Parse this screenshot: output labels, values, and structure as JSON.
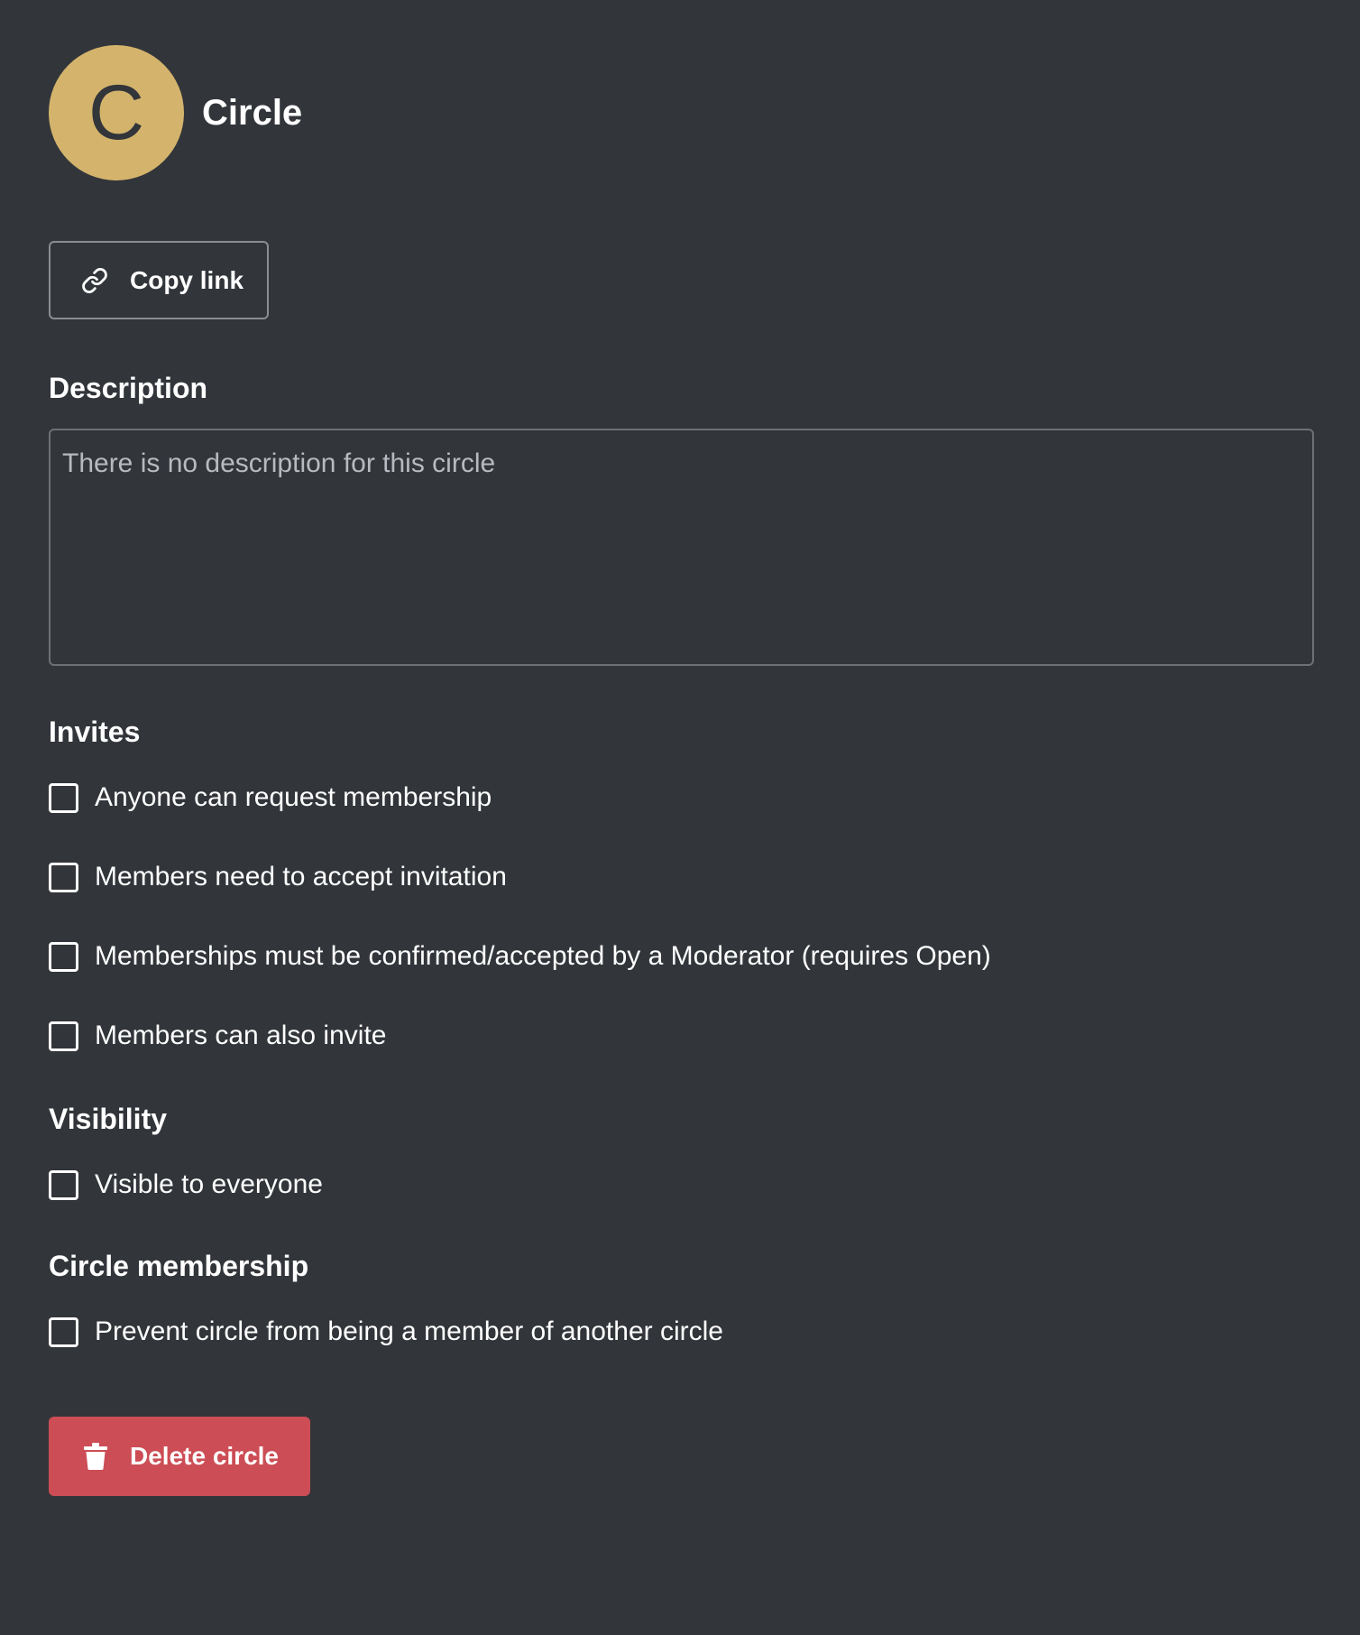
{
  "colors": {
    "background": "#32353a",
    "avatar": "#d4b46c",
    "danger": "#cc4d55"
  },
  "circle": {
    "avatar_letter": "C",
    "name": "Circle"
  },
  "copy_link": {
    "label": "Copy link",
    "icon": "link-icon"
  },
  "description": {
    "title": "Description",
    "placeholder": "There is no description for this circle",
    "value": ""
  },
  "invites": {
    "title": "Invites",
    "options": [
      {
        "label": "Anyone can request membership",
        "checked": false
      },
      {
        "label": "Members need to accept invitation",
        "checked": false
      },
      {
        "label": "Memberships must be confirmed/accepted by a Moderator (requires Open)",
        "checked": false
      },
      {
        "label": "Members can also invite",
        "checked": false
      }
    ]
  },
  "visibility": {
    "title": "Visibility",
    "options": [
      {
        "label": "Visible to everyone",
        "checked": false
      }
    ]
  },
  "membership": {
    "title": "Circle membership",
    "options": [
      {
        "label": "Prevent circle from being a member of another circle",
        "checked": false
      }
    ]
  },
  "delete": {
    "label": "Delete circle",
    "icon": "trash-icon"
  }
}
